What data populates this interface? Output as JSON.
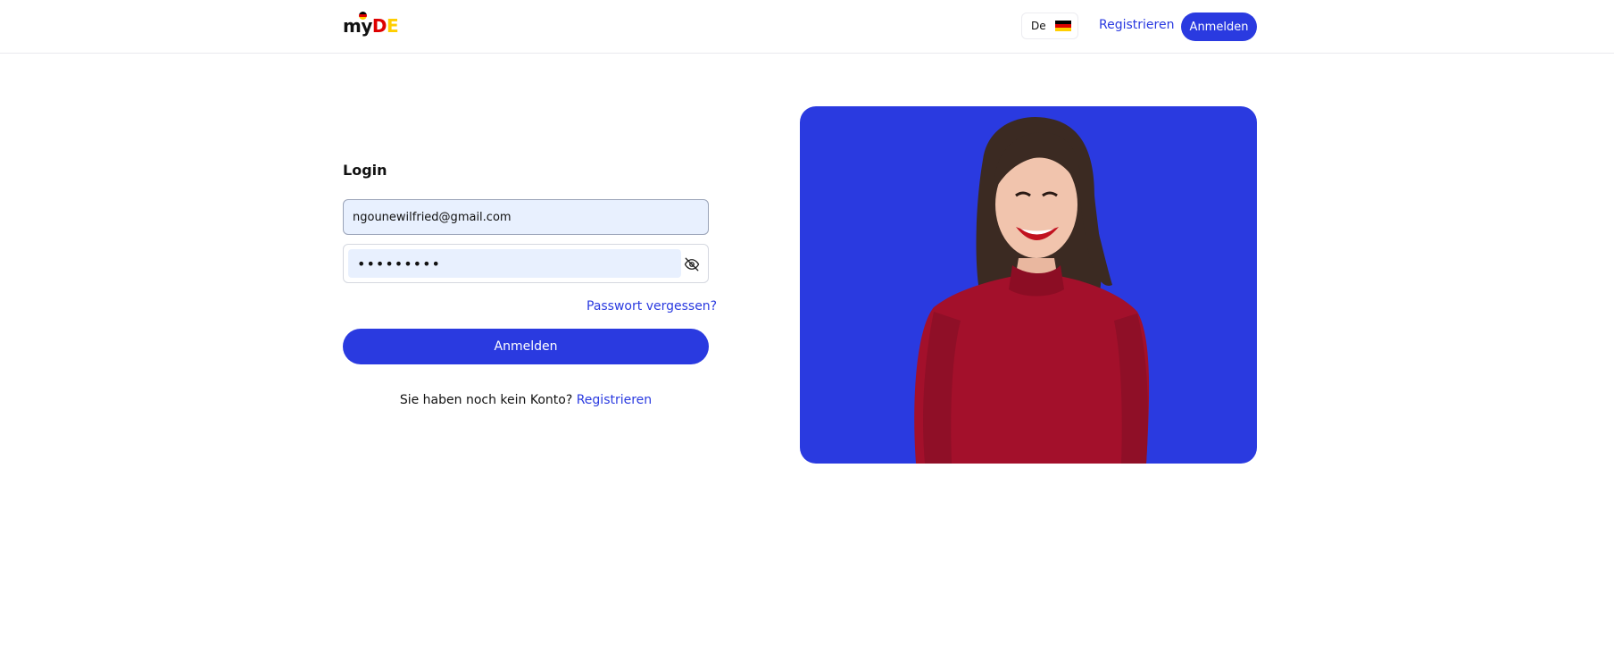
{
  "header": {
    "logo": {
      "my": "my",
      "d": "D",
      "e": "E"
    },
    "language": {
      "label": "De",
      "flag": "flag-germany-icon"
    },
    "register_label": "Registrieren",
    "login_label": "Anmelden"
  },
  "login": {
    "title": "Login",
    "email_value": "ngounewilfried@gmail.com",
    "password_value": "•••••••••",
    "forgot_label": "Passwort vergessen?",
    "submit_label": "Anmelden",
    "no_account_text": "Sie haben noch kein Konto?",
    "register_link": "Registrieren"
  },
  "colors": {
    "brand": "#2a3ae0",
    "input_autofill": "#e8f0fe"
  },
  "icons": {
    "password_toggle": "eye-off-icon"
  }
}
